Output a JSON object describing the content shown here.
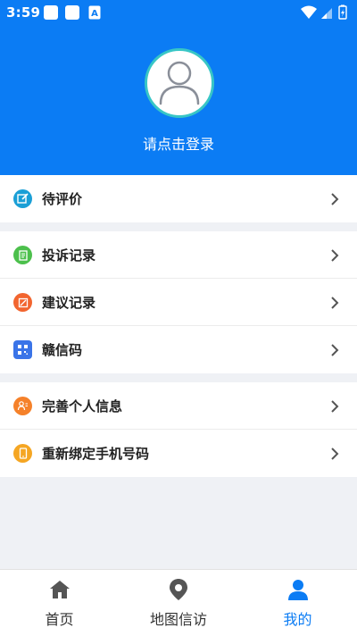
{
  "status_bar": {
    "time": "3:59",
    "notif_letter": "A"
  },
  "profile": {
    "login_prompt": "请点击登录"
  },
  "groups": [
    [
      {
        "label": "待评价",
        "icon": "edit-icon",
        "color": "#1a9fd6"
      }
    ],
    [
      {
        "label": "投诉记录",
        "icon": "document-icon",
        "color": "#4cc04c"
      },
      {
        "label": "建议记录",
        "icon": "pencil-note-icon",
        "color": "#f2652f"
      },
      {
        "label": "赣信码",
        "icon": "qr-code-icon",
        "color": "#3a74e8"
      }
    ],
    [
      {
        "label": "完善个人信息",
        "icon": "user-card-icon",
        "color": "#f5812a"
      },
      {
        "label": "重新绑定手机号码",
        "icon": "phone-icon",
        "color": "#f5a623"
      }
    ]
  ],
  "tabs": [
    {
      "label": "首页",
      "icon": "home-icon",
      "active": false
    },
    {
      "label": "地图信访",
      "icon": "map-pin-icon",
      "active": false
    },
    {
      "label": "我的",
      "icon": "person-icon",
      "active": true
    }
  ],
  "colors": {
    "primary": "#0b7cf4",
    "background": "#eff1f5",
    "avatar_ring": "#38c6c6"
  }
}
